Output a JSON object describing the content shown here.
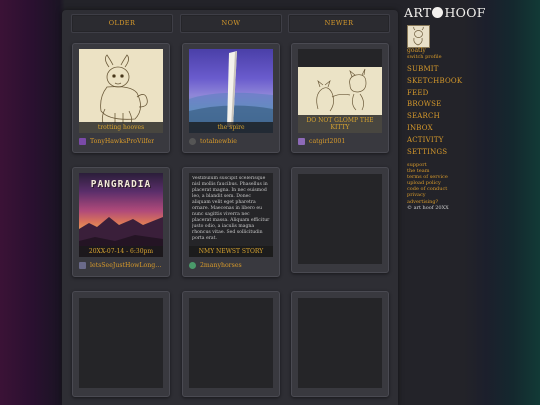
{
  "nav": {
    "older": "OLDER",
    "now": "NOW",
    "newer": "NEWER"
  },
  "cards": [
    {
      "caption": "trotting hooves",
      "user": "TonyHawksProVilfer"
    },
    {
      "caption": "the spire",
      "user": "totalnewbie"
    },
    {
      "caption": "DO NOT GLOMP THE KITTY",
      "user": "catgirl2001"
    },
    {
      "art_title": "PANGRADIA",
      "caption": "20XX-07-14 - 6:30pm",
      "user": "letsSeeJustHowLongOf..."
    },
    {
      "story_text": "Vestibulum suscipit scelerisque nisl mollis faucibus. Phasellus in placerat magna. In nec euismod leo, a blandit sem. Donec aliquam velit eget pharetra ornare. Maecenas in libero eu nunc sagittis viverra nec placerat massa. Aliquam efficitur justo odio, a iaculis magna rhoncus vitae. Sed sollicitudin porta erat.",
      "caption": "NMY NEWST STORY",
      "user": "2manyhorses"
    }
  ],
  "sidebar": {
    "logo_left": "ART",
    "logo_right": "HOOF",
    "username": "goatly",
    "switch_profile": "switch profile",
    "menu": [
      "SUBMIT",
      "SKETCHBOOK",
      "FEED",
      "BROWSE",
      "SEARCH",
      "INBOX",
      "ACTIVITY",
      "SETTINGS"
    ],
    "links": [
      "support",
      "the team",
      "terms of service",
      "upload policy",
      "code of conduct",
      "privacy",
      "advertising?"
    ],
    "copyright": "© art hoof 20XX"
  },
  "colors": {
    "accent": "#d79a2b",
    "panel": "#2e2e34",
    "card": "#39393f"
  }
}
